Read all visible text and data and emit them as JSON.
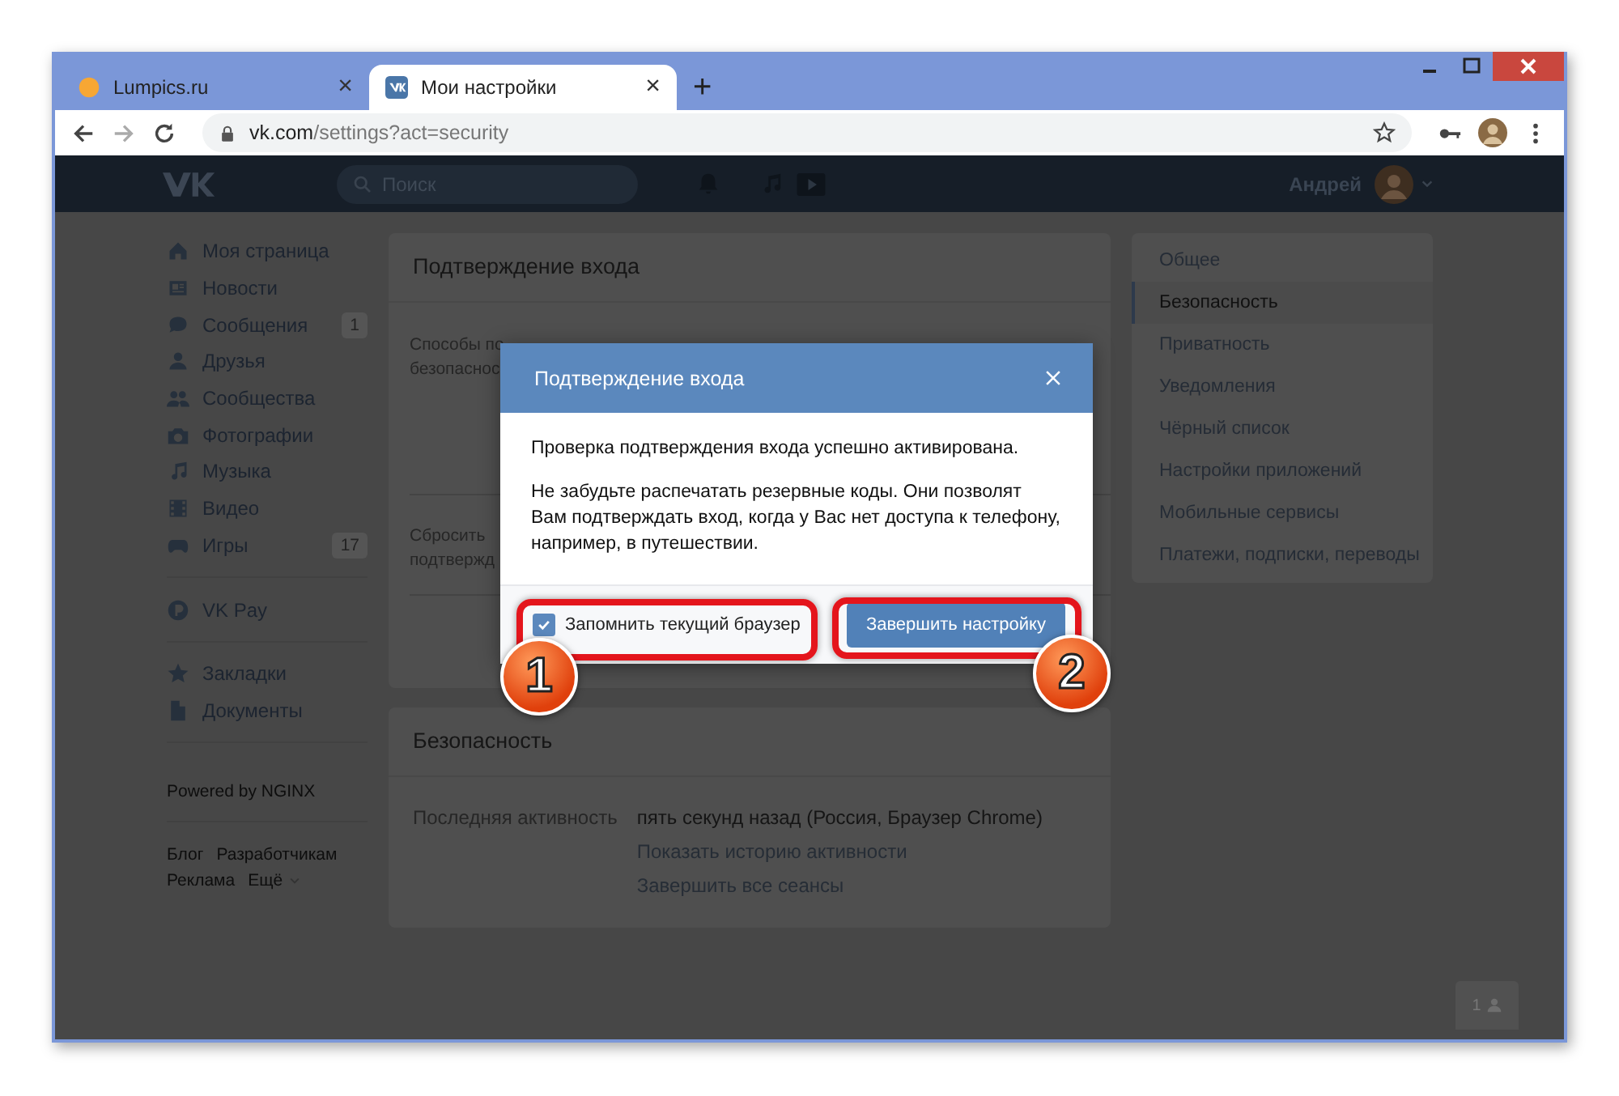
{
  "browser": {
    "tabs": [
      {
        "title": "Lumpics.ru",
        "selected": false,
        "close": "×"
      },
      {
        "title": "Мои настройки",
        "selected": true,
        "close": "×"
      }
    ],
    "new_tab": "+",
    "address": {
      "domain": "vk.com",
      "path": "/settings?act=security"
    }
  },
  "header": {
    "search": {
      "placeholder": "Поиск"
    },
    "user_name": "Андрей"
  },
  "nav": {
    "groups": [
      [
        {
          "label": "Моя страница"
        },
        {
          "label": "Новости"
        },
        {
          "label": "Сообщения",
          "badge": "1"
        },
        {
          "label": "Друзья"
        },
        {
          "label": "Сообщества"
        },
        {
          "label": "Фотографии"
        },
        {
          "label": "Музыка"
        },
        {
          "label": "Видео"
        },
        {
          "label": "Игры",
          "badge": "17"
        }
      ],
      [
        {
          "label": "VK Pay"
        }
      ],
      [
        {
          "label": "Закладки"
        },
        {
          "label": "Документы"
        }
      ]
    ],
    "powered": "Powered by NGINX",
    "footer_links": [
      [
        "Блог",
        "Разработчикам"
      ],
      [
        "Реклама",
        "Ещё"
      ]
    ]
  },
  "login_card": {
    "title": "Подтверждение входа",
    "covered_labels": [
      [
        "Способы по",
        "безопаснос"
      ],
      [
        "Сбросить",
        "подтвержд"
      ]
    ]
  },
  "security_card": {
    "title": "Безопасность",
    "label": "Последняя активность",
    "value": "пять секунд назад (Россия, Браузер Chrome)",
    "links": [
      "Показать историю активности",
      "Завершить все сеансы"
    ]
  },
  "settings_menu": [
    {
      "label": "Общее",
      "selected": false
    },
    {
      "label": "Безопасность",
      "selected": true
    },
    {
      "label": "Приватность",
      "selected": false
    },
    {
      "label": "Уведомления",
      "selected": false
    },
    {
      "label": "Чёрный список",
      "selected": false
    },
    {
      "label": "Настройки приложений",
      "selected": false
    },
    {
      "label": "Мобильные сервисы",
      "selected": false
    },
    {
      "label": "Платежи, подписки, переводы",
      "selected": false
    }
  ],
  "dialog": {
    "title": "Подтверждение входа",
    "paragraphs": [
      "Проверка подтверждения входа успешно активирована.",
      "Не забудьте распечатать резервные коды. Они позволят Вам подтверждать вход, когда у Вас нет доступа к телефону, например, в путешествии."
    ],
    "checkbox": {
      "label": "Запомнить текущий браузер",
      "checked": true
    },
    "button": "Завершить настройку"
  },
  "annotations": [
    {
      "number": "1"
    },
    {
      "number": "2"
    }
  ],
  "online_button": {
    "count": "1"
  }
}
